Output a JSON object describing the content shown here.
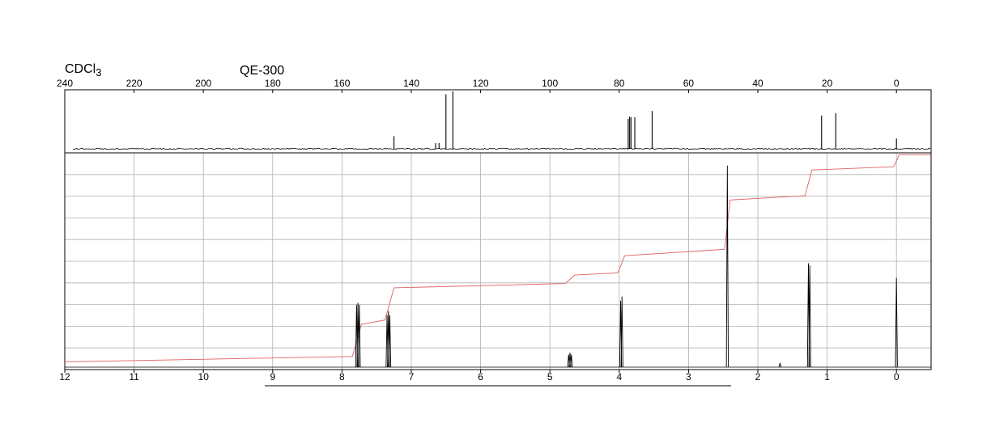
{
  "solvent": {
    "main": "CDCl",
    "subscript": "3"
  },
  "instrument": "QE-300",
  "chart_data": [
    {
      "type": "line",
      "name_in_image": "",
      "xlim": [
        240,
        -10
      ],
      "x_ticks": [
        240,
        220,
        200,
        180,
        160,
        140,
        120,
        100,
        80,
        60,
        40,
        20,
        0
      ],
      "grid": false,
      "peaks": [
        {
          "x": 145.0,
          "height": 0.22
        },
        {
          "x": 133.0,
          "height": 0.1
        },
        {
          "x": 132.0,
          "height": 0.1
        },
        {
          "x": 130.0,
          "height": 0.95
        },
        {
          "x": 128.0,
          "height": 1.0
        },
        {
          "x": 77.4,
          "height": 0.52
        },
        {
          "x": 77.0,
          "height": 0.56
        },
        {
          "x": 76.6,
          "height": 0.55
        },
        {
          "x": 75.5,
          "height": 0.55
        },
        {
          "x": 70.5,
          "height": 0.66
        },
        {
          "x": 21.6,
          "height": 0.58
        },
        {
          "x": 17.5,
          "height": 0.62
        },
        {
          "x": 0.0,
          "height": 0.18
        }
      ]
    },
    {
      "type": "line",
      "xlim": [
        12,
        -0.5
      ],
      "x_ticks": [
        12,
        11,
        10,
        9,
        8,
        7,
        6,
        5,
        4,
        3,
        2,
        1,
        0
      ],
      "grid": true,
      "peaks": [
        {
          "x": 7.79,
          "height": 0.3
        },
        {
          "x": 7.77,
          "height": 0.31
        },
        {
          "x": 7.75,
          "height": 0.3
        },
        {
          "x": 7.35,
          "height": 0.25
        },
        {
          "x": 7.33,
          "height": 0.27
        },
        {
          "x": 7.31,
          "height": 0.25
        },
        {
          "x": 4.73,
          "height": 0.06
        },
        {
          "x": 4.71,
          "height": 0.07
        },
        {
          "x": 4.69,
          "height": 0.06
        },
        {
          "x": 3.98,
          "height": 0.32
        },
        {
          "x": 3.96,
          "height": 0.34
        },
        {
          "x": 2.44,
          "height": 0.97
        },
        {
          "x": 1.68,
          "height": 0.02
        },
        {
          "x": 1.27,
          "height": 0.5
        },
        {
          "x": 1.25,
          "height": 0.49
        },
        {
          "x": 0.0,
          "height": 0.43
        }
      ],
      "integral": [
        {
          "x": 12.0,
          "y": 0.025
        },
        {
          "x": 7.85,
          "y": 0.05
        },
        {
          "x": 7.72,
          "y": 0.2
        },
        {
          "x": 7.38,
          "y": 0.22
        },
        {
          "x": 7.25,
          "y": 0.37
        },
        {
          "x": 4.78,
          "y": 0.39
        },
        {
          "x": 4.64,
          "y": 0.43
        },
        {
          "x": 4.02,
          "y": 0.44
        },
        {
          "x": 3.92,
          "y": 0.52
        },
        {
          "x": 2.48,
          "y": 0.55
        },
        {
          "x": 2.4,
          "y": 0.78
        },
        {
          "x": 1.32,
          "y": 0.8
        },
        {
          "x": 1.22,
          "y": 0.92
        },
        {
          "x": 0.04,
          "y": 0.935
        },
        {
          "x": -0.04,
          "y": 0.99
        },
        {
          "x": -0.5,
          "y": 0.99
        }
      ]
    }
  ]
}
